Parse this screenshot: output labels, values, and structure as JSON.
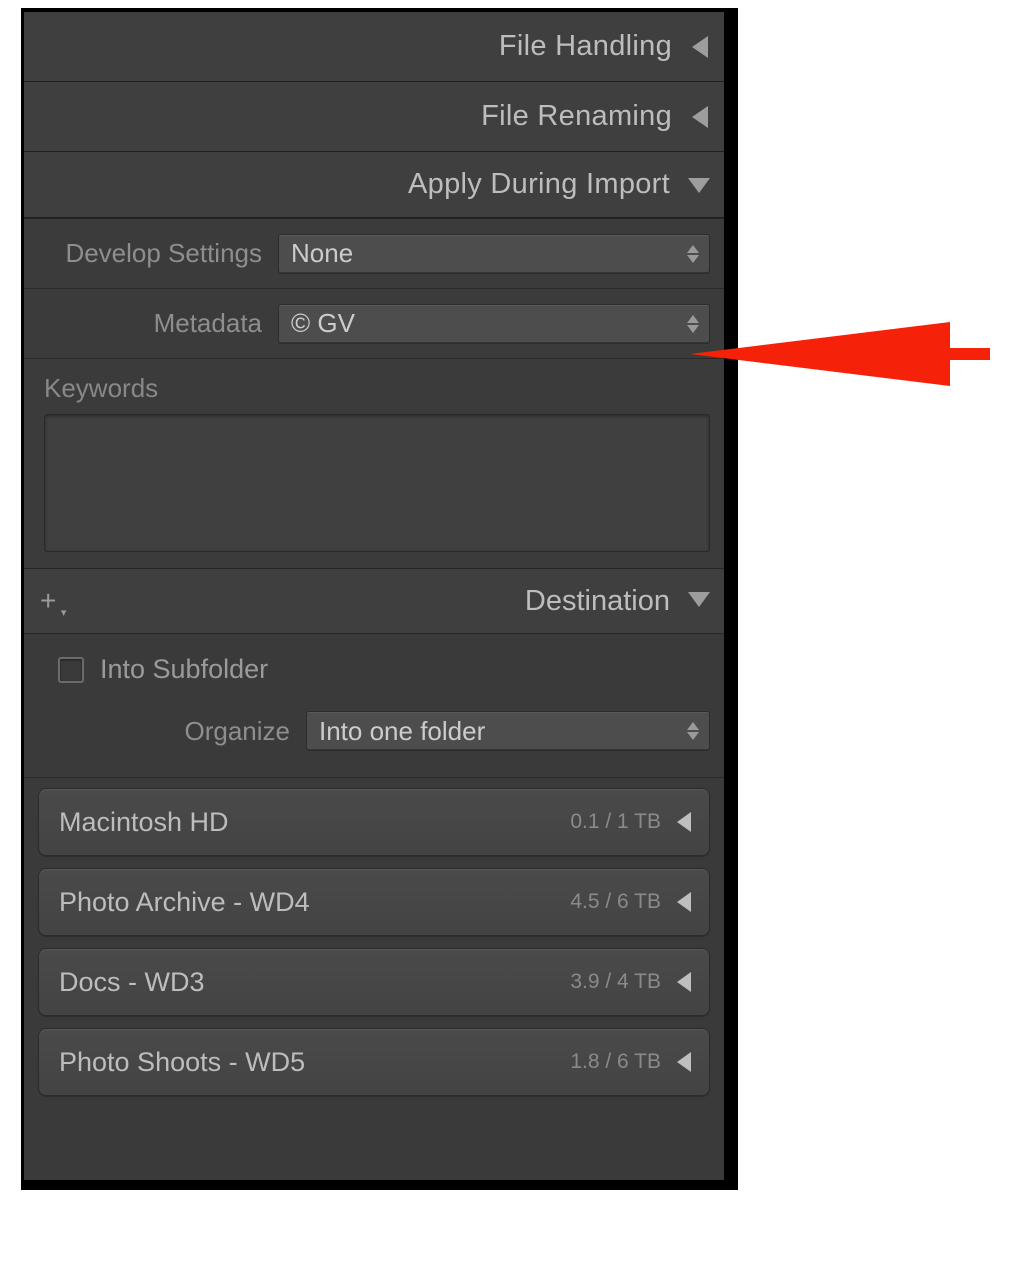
{
  "sections": {
    "file_handling": {
      "title": "File Handling"
    },
    "file_renaming": {
      "title": "File Renaming"
    },
    "apply_during_import": {
      "title": "Apply During Import",
      "develop_settings": {
        "label": "Develop Settings",
        "value": "None"
      },
      "metadata": {
        "label": "Metadata",
        "value": "© GV"
      },
      "keywords": {
        "label": "Keywords",
        "value": ""
      }
    },
    "destination": {
      "title": "Destination",
      "into_subfolder": {
        "label": "Into Subfolder",
        "checked": false
      },
      "organize": {
        "label": "Organize",
        "value": "Into one folder"
      },
      "drives": [
        {
          "name": "Macintosh HD",
          "size": "0.1 / 1 TB"
        },
        {
          "name": "Photo Archive - WD4",
          "size": "4.5 / 6 TB"
        },
        {
          "name": "Docs - WD3",
          "size": "3.9 / 4 TB"
        },
        {
          "name": "Photo Shoots - WD5",
          "size": "1.8 / 6 TB"
        }
      ]
    }
  }
}
